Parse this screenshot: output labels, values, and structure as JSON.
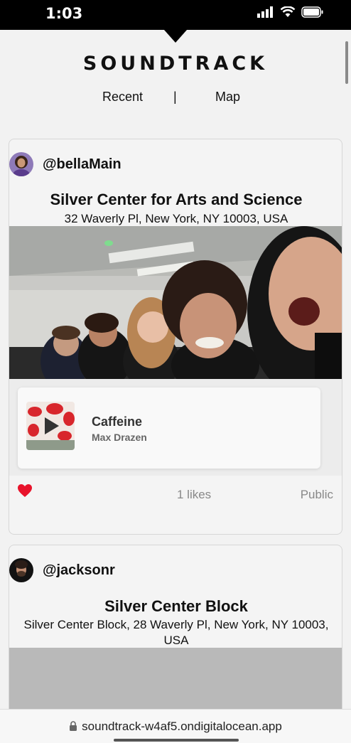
{
  "status": {
    "time": "1:03"
  },
  "app": {
    "title": "SOUNDTRACK"
  },
  "nav": {
    "recent": "Recent",
    "separator": "|",
    "map": "Map"
  },
  "posts": [
    {
      "username": "@bellaMain",
      "place_name": "Silver Center for Arts and Science",
      "address": "32 Waverly Pl, New York, NY 10003, USA",
      "song": {
        "title": "Caffeine",
        "artist": "Max Drazen"
      },
      "likes": "1 likes",
      "visibility": "Public",
      "liked": true
    },
    {
      "username": "@jacksonr",
      "place_name": "Silver Center Block",
      "address": "Silver Center Block, 28 Waverly Pl, New York, NY 10003, USA"
    }
  ],
  "browser": {
    "url": "soundtrack-w4af5.ondigitalocean.app"
  },
  "colors": {
    "heart": "#e8132b",
    "background": "#f2f2f2"
  }
}
